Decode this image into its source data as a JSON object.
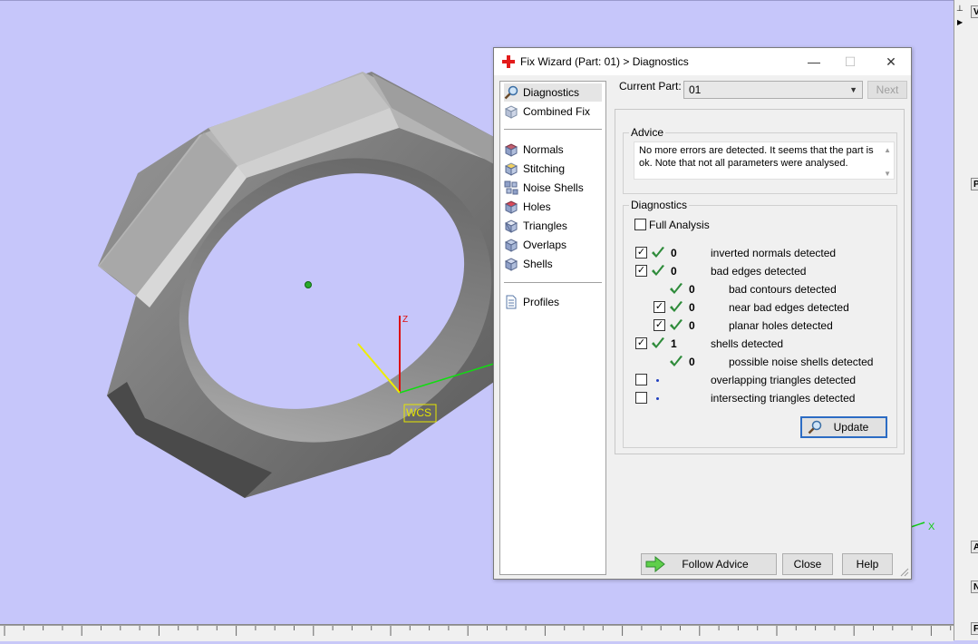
{
  "dialog": {
    "title": "Fix Wizard (Part: 01) > Diagnostics",
    "window_controls": {
      "minimize": "—",
      "maximize": "☐",
      "close": "✕"
    }
  },
  "nav": {
    "items_top": [
      {
        "label": "Diagnostics",
        "icon": "magnifier-icon",
        "selected": true
      },
      {
        "label": "Combined Fix",
        "icon": "cube-icon",
        "selected": false
      }
    ],
    "items_fix": [
      {
        "label": "Normals",
        "icon": "normals-icon"
      },
      {
        "label": "Stitching",
        "icon": "stitching-icon"
      },
      {
        "label": "Noise Shells",
        "icon": "noise-shells-icon"
      },
      {
        "label": "Holes",
        "icon": "holes-icon"
      },
      {
        "label": "Triangles",
        "icon": "triangles-icon"
      },
      {
        "label": "Overlaps",
        "icon": "overlaps-icon"
      },
      {
        "label": "Shells",
        "icon": "shells-icon"
      }
    ],
    "items_bottom": [
      {
        "label": "Profiles",
        "icon": "document-icon"
      }
    ]
  },
  "current_part": {
    "label": "Current Part:",
    "value": "01",
    "next_label": "Next"
  },
  "advice": {
    "title": "Advice",
    "text": "No more errors are detected. It seems that the part is ok. Note that not all parameters were analysed."
  },
  "diagnostics": {
    "title": "Diagnostics",
    "full_analysis": {
      "label": "Full Analysis",
      "checked": false
    },
    "rows": [
      {
        "checkbox": true,
        "checked": true,
        "status": "check",
        "count": "0",
        "label": "inverted normals detected",
        "indent": 0
      },
      {
        "checkbox": true,
        "checked": true,
        "status": "check",
        "count": "0",
        "label": "bad edges detected",
        "indent": 0
      },
      {
        "checkbox": false,
        "checked": false,
        "status": "check",
        "count": "0",
        "label": "bad contours detected",
        "indent": 1
      },
      {
        "checkbox": true,
        "checked": true,
        "status": "check",
        "count": "0",
        "label": "near bad edges detected",
        "indent": 1
      },
      {
        "checkbox": true,
        "checked": true,
        "status": "check",
        "count": "0",
        "label": "planar holes detected",
        "indent": 1
      },
      {
        "checkbox": true,
        "checked": true,
        "status": "check",
        "count": "1",
        "label": "shells detected",
        "indent": 0
      },
      {
        "checkbox": false,
        "checked": false,
        "status": "check",
        "count": "0",
        "label": "possible noise shells detected",
        "indent": 1
      },
      {
        "checkbox": true,
        "checked": false,
        "status": "dot",
        "count": "",
        "label": "overlapping triangles detected",
        "indent": 0
      },
      {
        "checkbox": true,
        "checked": false,
        "status": "dot",
        "count": "",
        "label": "intersecting triangles detected",
        "indent": 0
      }
    ],
    "update_label": "Update"
  },
  "footer": {
    "follow_advice": "Follow Advice",
    "close": "Close",
    "help": "Help"
  },
  "viewport": {
    "wcs_label": "WCS",
    "axis_x": "X",
    "axis_z": "Z"
  },
  "right_panel": {
    "tabs": [
      "V",
      "P",
      "A",
      "N",
      "F"
    ]
  },
  "colors": {
    "viewport_bg": "#c6c6fa",
    "check_green": "#2e8b3a",
    "accent_blue": "#2c6cc4"
  }
}
